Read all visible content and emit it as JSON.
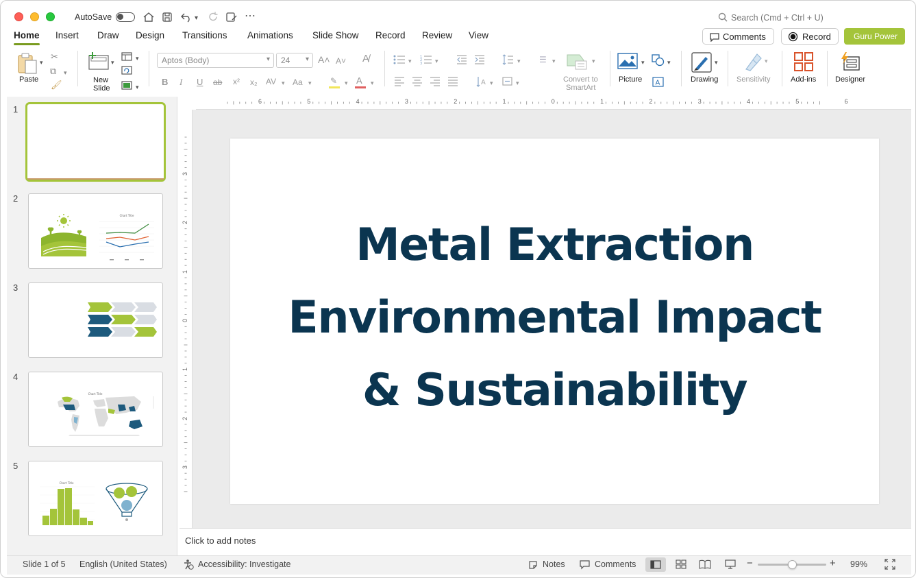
{
  "titlebar": {
    "autosave_label": "AutoSave",
    "search_placeholder": "Search (Cmd + Ctrl + U)"
  },
  "tabs": [
    {
      "label": "Home",
      "active": true
    },
    {
      "label": "Insert"
    },
    {
      "label": "Draw"
    },
    {
      "label": "Design"
    },
    {
      "label": "Transitions"
    },
    {
      "label": "Animations"
    },
    {
      "label": "Slide Show"
    },
    {
      "label": "Record"
    },
    {
      "label": "Review"
    },
    {
      "label": "View"
    }
  ],
  "top_buttons": {
    "comments": "Comments",
    "record": "Record",
    "guru": "Guru Power"
  },
  "ribbon": {
    "paste": "Paste",
    "new_slide_line1": "New",
    "new_slide_line2": "Slide",
    "font_name": "Aptos (Body)",
    "font_size": "24",
    "convert_line1": "Convert to",
    "convert_line2": "SmartArt",
    "picture": "Picture",
    "drawing": "Drawing",
    "sensitivity": "Sensitivity",
    "addins": "Add-ins",
    "designer": "Designer"
  },
  "thumbnails": [
    {
      "number": "1",
      "selected": true
    },
    {
      "number": "2",
      "chart_title": "Chart Title"
    },
    {
      "number": "3"
    },
    {
      "number": "4",
      "chart_title": "Chart Title"
    },
    {
      "number": "5",
      "chart_title": "Chart Title"
    }
  ],
  "ruler": {
    "h_labels": [
      "6",
      "5",
      "4",
      "3",
      "2",
      "1",
      "0",
      "1",
      "2",
      "3",
      "4",
      "5",
      "6"
    ],
    "v_labels": [
      "3",
      "2",
      "1",
      "0",
      "1",
      "2",
      "3"
    ]
  },
  "slide": {
    "title_lines": [
      "Metal Extraction",
      "Environmental Impact",
      "& Sustainability"
    ],
    "title_color": "#0b3550"
  },
  "notes_placeholder": "Click to add notes",
  "status": {
    "slide_of": "Slide 1 of 5",
    "language": "English (United States)",
    "accessibility": "Accessibility: Investigate",
    "notes": "Notes",
    "comments": "Comments",
    "zoom": "99%",
    "zoom_level_fraction": 0.5
  },
  "colors": {
    "accent_green": "#a4c43a",
    "tab_underline": "#7a9b1f",
    "dark_teal": "#1d5a7d"
  }
}
